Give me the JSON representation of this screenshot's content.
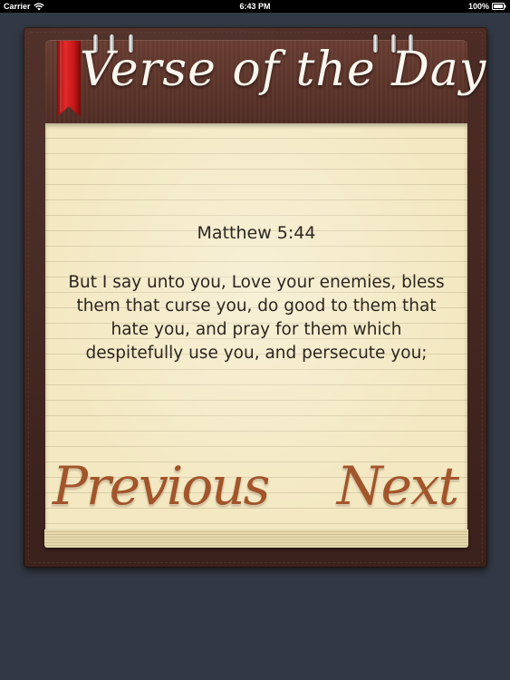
{
  "status_bar": {
    "carrier": "Carrier",
    "time": "6:43 PM",
    "battery": "100%"
  },
  "header": {
    "title": "Verse of the Day"
  },
  "verse": {
    "reference": "Matthew 5:44",
    "text": "But I say unto you, Love your enemies, bless them that curse you, do good to them that hate you, and pray for them which despitefully use you, and persecute you;"
  },
  "nav": {
    "previous_label": "Previous",
    "next_label": "Next"
  },
  "icons": {
    "signal": "wifi-icon",
    "battery": "battery-icon",
    "bookmark": "bookmark-ribbon-icon",
    "clip": "binder-clip-icon"
  },
  "colors": {
    "background": "#323944",
    "leather": "#4c2c25",
    "header": "#5a3329",
    "paper": "#f3e8c1",
    "title": "#fbf7ef",
    "text": "#2c2620",
    "nav": "#a2552a",
    "ribbon": "#d31f1f"
  }
}
